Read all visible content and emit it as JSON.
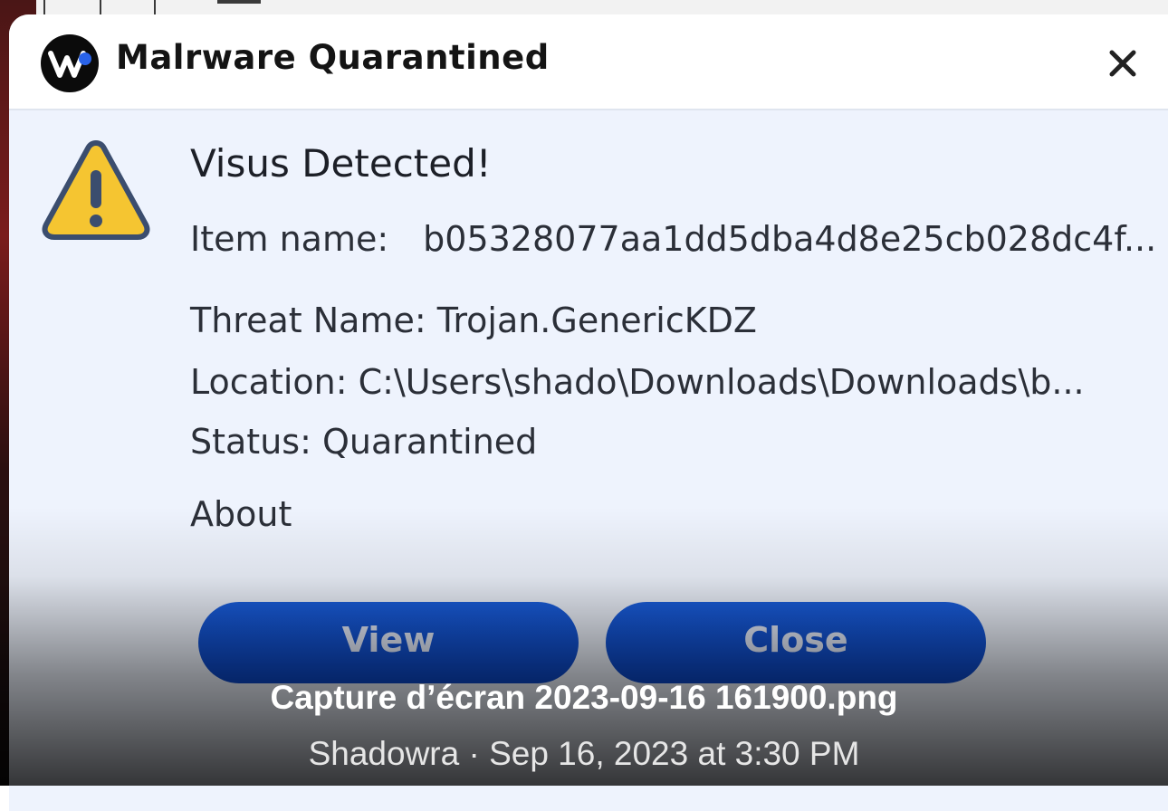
{
  "dialog": {
    "title": "Malrware Quarantined",
    "close_icon": "close-icon",
    "logo_icon": "app-logo-icon",
    "warning_icon": "warning-triangle-icon",
    "headline": "Visus Detected!",
    "item_name_label": "Item name:",
    "item_name_value": "b05328077aa1dd5dba4d8e25cb028dc4f...",
    "threat_name": "Threat Name: Trojan.GenericKDZ",
    "location": "Location: C:\\Users\\shado\\Downloads\\Downloads\\b...",
    "status": "Status: Quarantined",
    "about_link": "About",
    "buttons": {
      "view": "View",
      "close": "Close"
    },
    "colors": {
      "button": "#0d4fd4",
      "body_background": "#eef3fd",
      "warning_fill": "#f5c531",
      "warning_outline": "#3b4d6e"
    }
  },
  "caption": {
    "filename": "Capture d’écran 2023-09-16 161900.png",
    "meta": "Shadowra · Sep 16, 2023 at 3:30 PM"
  }
}
